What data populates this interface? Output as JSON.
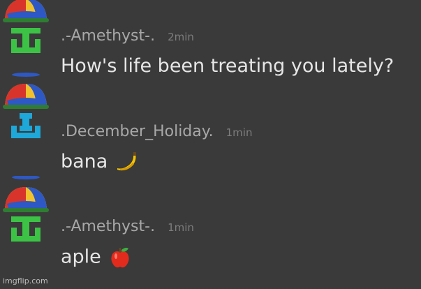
{
  "messages": [
    {
      "username": ".-Amethyst-.",
      "timestamp": "2min",
      "text": "How's life been treating you lately?",
      "emoji": "",
      "avatar_icon": "propeller-cap-green-logo-icon",
      "avatar_logo_color": "#3cc245"
    },
    {
      "username": ".December_Holiday.",
      "timestamp": "1min",
      "text": "bana",
      "emoji": "banana-icon",
      "avatar_icon": "propeller-cap-blue-logo-icon",
      "avatar_logo_color": "#1ea7d9"
    },
    {
      "username": ".-Amethyst-.",
      "timestamp": "1min",
      "text": "aple",
      "emoji": "apple-icon",
      "avatar_icon": "propeller-cap-green-logo-icon",
      "avatar_logo_color": "#3cc245"
    }
  ],
  "watermark": "imgflip.com",
  "colors": {
    "background": "#3a3a3a",
    "username": "#a8a8a8",
    "timestamp": "#7d7d7d",
    "message_text": "#e6e6e6"
  }
}
